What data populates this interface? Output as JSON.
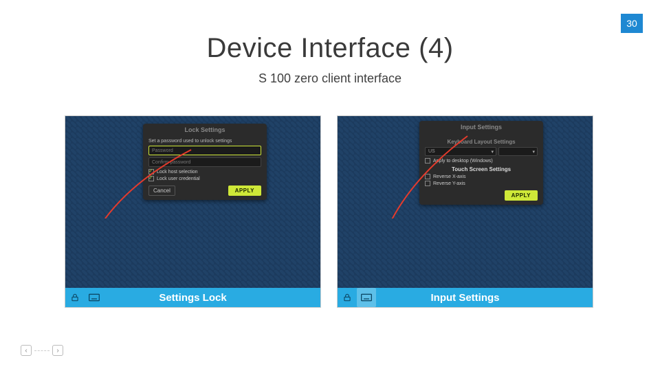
{
  "page_number": "30",
  "title": "Device Interface (4)",
  "subtitle": "S 100 zero client interface",
  "left": {
    "caption": "Settings Lock",
    "dialog_title": "Lock Settings",
    "prompt": "Set a password used to unlock settings",
    "password_placeholder": "Password",
    "confirm_placeholder": "Confirm password",
    "lock_host": "Lock host selection",
    "lock_user": "Lock user credential",
    "cancel": "Cancel",
    "apply": "APPLY"
  },
  "right": {
    "caption": "Input Settings",
    "dialog_title": "Input Settings",
    "keyboard_section": "Keyboard Layout Settings",
    "keyboard_value": "US",
    "apply_desktop": "Apply to desktop (Windows)",
    "touch_section": "Touch Screen Settings",
    "reverse_x": "Reverse X-axis",
    "reverse_y": "Reverse Y-axis",
    "apply": "APPLY"
  },
  "icons": {
    "lock": "lock-icon",
    "keyboard": "keyboard-icon",
    "prev": "‹",
    "next": "›"
  }
}
